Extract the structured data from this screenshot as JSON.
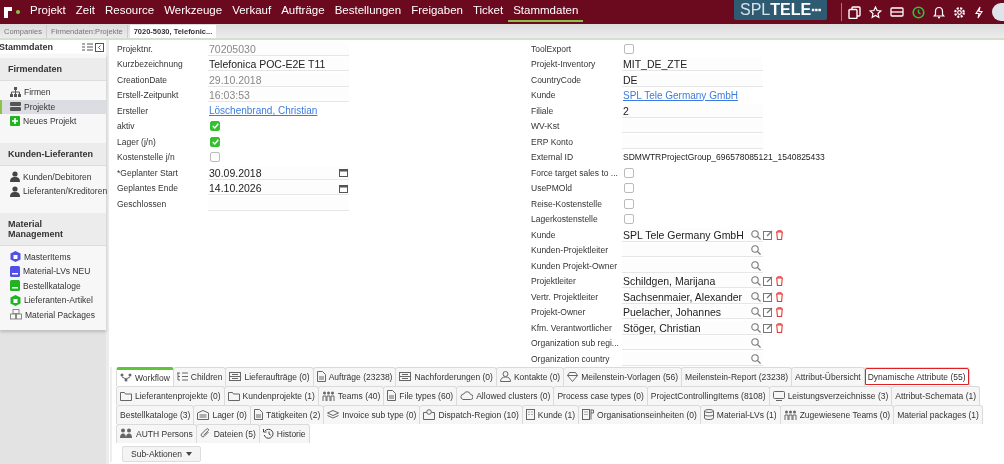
{
  "nav": {
    "items": [
      {
        "label": "Projekt",
        "selected": false
      },
      {
        "label": "Zeit",
        "selected": false
      },
      {
        "label": "Resource",
        "selected": false
      },
      {
        "label": "Werkzeuge",
        "selected": false
      },
      {
        "label": "Verkauf",
        "selected": false
      },
      {
        "label": "Aufträge",
        "selected": false
      },
      {
        "label": "Bestellungen",
        "selected": false
      },
      {
        "label": "Freigaben",
        "selected": false
      },
      {
        "label": "Ticket",
        "selected": false
      },
      {
        "label": "Stammdaten",
        "selected": true
      }
    ],
    "brand": {
      "light": "SPL",
      "bold": "TELE"
    }
  },
  "breadcrumbs": [
    {
      "label": "Companies",
      "selected": false
    },
    {
      "label": "Firmendaten:Projekte",
      "selected": false
    },
    {
      "label": "7020-5030, Telefonic...",
      "selected": true
    }
  ],
  "sidebar": {
    "title": "Stammdaten",
    "sections": [
      {
        "title": "Firmendaten",
        "items": [
          {
            "label": "Firmen",
            "selected": false
          },
          {
            "label": "Projekte",
            "selected": true
          },
          {
            "label": "Neues Projekt",
            "selected": false
          }
        ]
      },
      {
        "title": "Kunden-Lieferanten",
        "items": [
          {
            "label": "Kunden/Debitoren",
            "selected": false
          },
          {
            "label": "Lieferanten/Kreditoren",
            "selected": false
          }
        ]
      },
      {
        "title": "Material Management",
        "items": [
          {
            "label": "MasterItems",
            "selected": false
          },
          {
            "label": "Material-LVs NEU",
            "selected": false
          },
          {
            "label": "Bestellkataloge",
            "selected": false
          },
          {
            "label": "Lieferanten-Artikel",
            "selected": false
          },
          {
            "label": "Material Packages",
            "selected": false
          }
        ]
      }
    ]
  },
  "form": {
    "left": [
      {
        "label": "Projektnr.",
        "kind": "readonly",
        "value": "70205030"
      },
      {
        "label": "Kurzbezeichnung",
        "kind": "text",
        "value": "Telefonica POC-E2E T11"
      },
      {
        "label": "CreationDate",
        "kind": "readonly",
        "value": "29.10.2018"
      },
      {
        "label": "Erstell-Zeitpunkt",
        "kind": "readonly",
        "value": "16:03:53"
      },
      {
        "label": "Ersteller",
        "kind": "link",
        "value": "Löschenbrand, Christian"
      },
      {
        "label": "aktiv",
        "kind": "checkbox",
        "checked": true
      },
      {
        "label": "Lager (j/n)",
        "kind": "checkbox",
        "checked": true
      },
      {
        "label": "Kostenstelle j/n",
        "kind": "checkbox",
        "checked": false
      },
      {
        "label": "*Geplanter Start",
        "kind": "date",
        "value": "30.09.2018"
      },
      {
        "label": "Geplantes Ende",
        "kind": "date",
        "value": "14.10.2026"
      },
      {
        "label": "Geschlossen",
        "kind": "empty"
      }
    ],
    "right": [
      {
        "label": "ToolExport",
        "kind": "checkbox",
        "checked": false
      },
      {
        "label": "Projekt-Inventory",
        "kind": "text",
        "value": "MIT_DE_ZTE"
      },
      {
        "label": "CountryCode",
        "kind": "text",
        "value": "DE"
      },
      {
        "label": "Kunde",
        "kind": "link",
        "value": "SPL Tele Germany GmbH"
      },
      {
        "label": "Filiale",
        "kind": "text",
        "value": "2"
      },
      {
        "label": "WV-Kst",
        "kind": "empty"
      },
      {
        "label": "ERP Konto",
        "kind": "empty"
      },
      {
        "label": "External ID",
        "kind": "plain",
        "value": "SDMWTRProjectGroup_696578085121_1540825433"
      },
      {
        "label": "Force target sales to ...",
        "kind": "checkbox",
        "checked": false
      },
      {
        "label": "UsePMOld",
        "kind": "checkbox",
        "checked": false
      },
      {
        "label": "Reise-Kostenstelle",
        "kind": "checkbox",
        "checked": false
      },
      {
        "label": "Lagerkostenstelle",
        "kind": "checkbox",
        "checked": false
      },
      {
        "label": "Kunde",
        "kind": "lookup",
        "value": "SPL Tele Germany GmbH",
        "editable": true
      },
      {
        "label": "Kunden-Projektleiter",
        "kind": "lookup",
        "editable": false
      },
      {
        "label": "Kunden Projekt-Owner",
        "kind": "lookup",
        "editable": false
      },
      {
        "label": "Projektleiter",
        "kind": "lookup",
        "value": "Schildgen, Marijana",
        "editable": true
      },
      {
        "label": "Vertr. Projektleiter",
        "kind": "lookup",
        "value": "Sachsenmaier, Alexander",
        "editable": true
      },
      {
        "label": "Projekt-Owner",
        "kind": "lookup",
        "value": "Puelacher, Johannes",
        "editable": true
      },
      {
        "label": "Kfm. Verantwortlicher",
        "kind": "lookup",
        "value": "Stöger, Christian",
        "editable": true
      },
      {
        "label": "Organization sub regi...",
        "kind": "lookup",
        "editable": false
      },
      {
        "label": "Organization country",
        "kind": "lookup",
        "editable": false
      }
    ]
  },
  "tab_rows": [
    [
      {
        "label": "Workflow",
        "kind": "icon",
        "selected": true,
        "highlighted": false
      },
      {
        "label": "Children",
        "kind": "icon",
        "selected": false,
        "highlighted": false
      },
      {
        "label": "Lieferaufträge (0)",
        "kind": "icon",
        "selected": false,
        "highlighted": false
      },
      {
        "label": "Aufträge (23238)",
        "kind": "icon",
        "selected": false,
        "highlighted": false
      },
      {
        "label": "Nachforderungen (0)",
        "kind": "icon",
        "selected": false,
        "highlighted": false
      },
      {
        "label": "Kontakte (0)",
        "kind": "icon",
        "selected": false,
        "highlighted": false
      },
      {
        "label": "Meilenstein-Vorlagen (56)",
        "kind": "icon",
        "selected": false,
        "highlighted": false
      },
      {
        "label": "Meilenstein-Report (23238)",
        "kind": "plain",
        "selected": false,
        "highlighted": false
      },
      {
        "label": "Attribut-Übersicht",
        "kind": "plain",
        "selected": false,
        "highlighted": false
      },
      {
        "label": "Dynamische Attribute (55)",
        "kind": "plain",
        "selected": false,
        "highlighted": true
      }
    ],
    [
      {
        "label": "Lieferantenprojekte (0)",
        "kind": "icon",
        "selected": false,
        "highlighted": false
      },
      {
        "label": "Kundenprojekte (1)",
        "kind": "icon",
        "selected": false,
        "highlighted": false
      },
      {
        "label": "Teams (40)",
        "kind": "icon",
        "selected": false,
        "highlighted": false
      },
      {
        "label": "File types (60)",
        "kind": "icon",
        "selected": false,
        "highlighted": false
      },
      {
        "label": "Allowed clusters (0)",
        "kind": "icon",
        "selected": false,
        "highlighted": false
      },
      {
        "label": "Process case types (0)",
        "kind": "plain",
        "selected": false,
        "highlighted": false
      },
      {
        "label": "ProjectControllingItems (8108)",
        "kind": "plain",
        "selected": false,
        "highlighted": false
      },
      {
        "label": "Leistungsverzeichnisse (3)",
        "kind": "icon",
        "selected": false,
        "highlighted": false
      },
      {
        "label": "Attribut-Schemata (1)",
        "kind": "plain",
        "selected": false,
        "highlighted": false
      }
    ],
    [
      {
        "label": "Bestellkataloge (3)",
        "kind": "plain",
        "selected": false,
        "highlighted": false
      },
      {
        "label": "Lager (0)",
        "kind": "icon",
        "selected": false,
        "highlighted": false
      },
      {
        "label": "Tätigkeiten (2)",
        "kind": "icon",
        "selected": false,
        "highlighted": false
      },
      {
        "label": "Invoice sub type (0)",
        "kind": "icon",
        "selected": false,
        "highlighted": false
      },
      {
        "label": "Dispatch-Region (10)",
        "kind": "icon",
        "selected": false,
        "highlighted": false
      },
      {
        "label": "Kunde (1)",
        "kind": "icon",
        "selected": false,
        "highlighted": false
      },
      {
        "label": "Organisationseinheiten (0)",
        "kind": "icon",
        "selected": false,
        "highlighted": false
      },
      {
        "label": "Material-LVs (1)",
        "kind": "icon",
        "selected": false,
        "highlighted": false
      },
      {
        "label": "Zugewiesene Teams (0)",
        "kind": "icon",
        "selected": false,
        "highlighted": false
      },
      {
        "label": "Material packages (1)",
        "kind": "plain",
        "selected": false,
        "highlighted": false
      }
    ],
    [
      {
        "label": "AUTH Persons",
        "kind": "icon",
        "selected": false,
        "highlighted": false
      },
      {
        "label": "Dateien (5)",
        "kind": "icon",
        "selected": false,
        "highlighted": false
      },
      {
        "label": "Historie",
        "kind": "icon",
        "selected": false,
        "highlighted": false
      }
    ]
  ],
  "sub_actions": {
    "label": "Sub-Aktionen"
  }
}
